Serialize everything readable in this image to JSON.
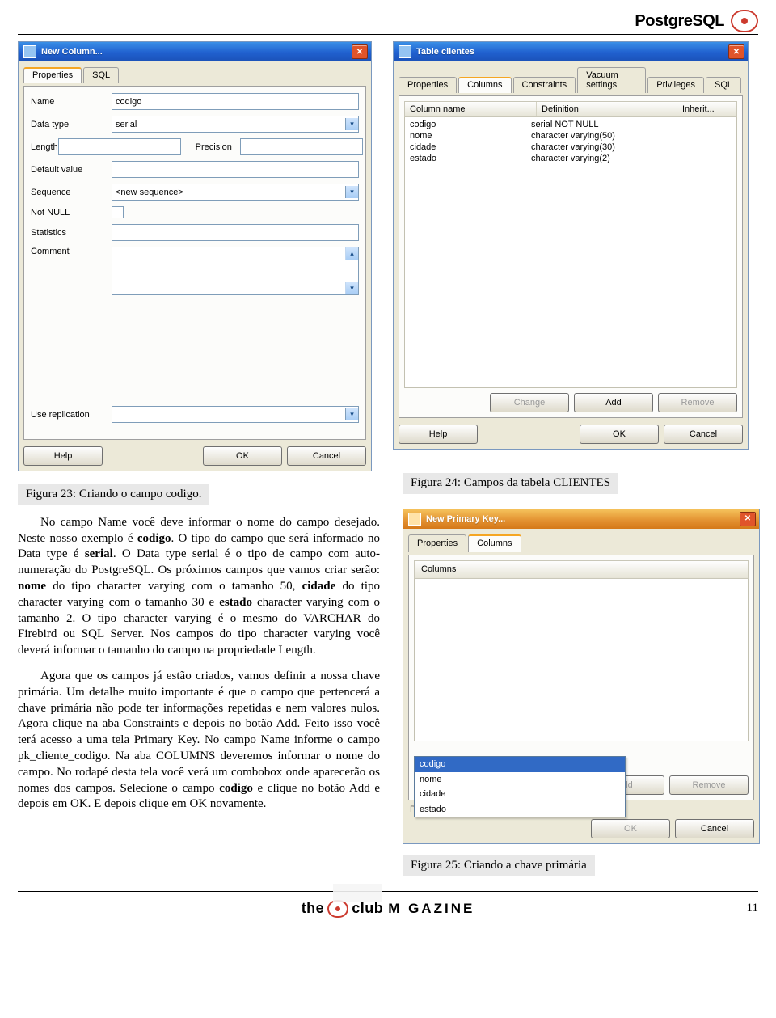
{
  "header": {
    "title": "PostgreSQL"
  },
  "newColumn": {
    "title": "New Column...",
    "tabs": {
      "properties": "Properties",
      "sql": "SQL"
    },
    "labels": {
      "name": "Name",
      "dataType": "Data type",
      "length": "Length",
      "precision": "Precision",
      "defaultValue": "Default value",
      "sequence": "Sequence",
      "notNull": "Not NULL",
      "statistics": "Statistics",
      "comment": "Comment",
      "useReplication": "Use replication"
    },
    "values": {
      "name": "codigo",
      "dataType": "serial",
      "sequence": "<new sequence>"
    },
    "buttons": {
      "help": "Help",
      "ok": "OK",
      "cancel": "Cancel"
    }
  },
  "tableClientes": {
    "title": "Table clientes",
    "tabs": {
      "properties": "Properties",
      "columns": "Columns",
      "constraints": "Constraints",
      "vacuum": "Vacuum settings",
      "privileges": "Privileges",
      "sql": "SQL"
    },
    "headers": {
      "columnName": "Column name",
      "definition": "Definition",
      "inherit": "Inherit..."
    },
    "rows": [
      {
        "name": "codigo",
        "def": "serial NOT NULL"
      },
      {
        "name": "nome",
        "def": "character varying(50)"
      },
      {
        "name": "cidade",
        "def": "character varying(30)"
      },
      {
        "name": "estado",
        "def": "character varying(2)"
      }
    ],
    "buttons": {
      "change": "Change",
      "add": "Add",
      "remove": "Remove",
      "help": "Help",
      "ok": "OK",
      "cancel": "Cancel"
    }
  },
  "captions": {
    "fig23": "Figura 23: Criando o campo codigo.",
    "fig24": "Figura 24: Campos da tabela CLIENTES",
    "fig25": "Figura 25: Criando a chave primária"
  },
  "article": {
    "p1a": "No campo Name você deve informar o nome do campo desejado. Neste nosso exemplo é ",
    "p1b": "codigo",
    "p1c": ". O tipo do campo que será informado no Data type é ",
    "p1d": "serial",
    "p1e": ". O Data type serial é o tipo de campo com auto-numeração do PostgreSQL. Os próximos campos que vamos criar serão: ",
    "p1f": "nome",
    "p1g": " do tipo character varying com o tamanho 50, ",
    "p1h": "cidade",
    "p1i": " do tipo character varying com o tamanho 30 e ",
    "p1j": "estado",
    "p1k": " character varying com o tamanho 2. O tipo character varying é o mesmo do VARCHAR do Firebird ou SQL Server. Nos campos do tipo character varying você deverá informar o tamanho do campo na propriedade Length.",
    "p2a": "Agora que os campos já estão criados, vamos definir a nossa chave primária. Um detalhe muito importante é que o campo que pertencerá a chave primária não pode ter informações repetidas e nem valores nulos. Agora clique na aba Constraints e depois no botão Add. Feito isso você terá acesso a uma tela Primary Key. No campo Name informe o campo pk_cliente_codigo. Na aba COLUMNS deveremos informar o nome do campo. No rodapé desta tela você verá um combobox onde aparecerão os nomes dos campos. Selecione o campo ",
    "p2b": "codigo",
    "p2c": " e clique no botão Add e depois em OK. E depois clique em OK novamente."
  },
  "primaryKey": {
    "title": "New Primary Key...",
    "tabs": {
      "properties": "Properties",
      "columns": "Columns"
    },
    "colHeader": "Columns",
    "options": [
      "codigo",
      "nome",
      "cidade",
      "estado"
    ],
    "selected": "codigo",
    "hint": "Please specify columns.",
    "buttons": {
      "add": "Add",
      "remove": "Remove",
      "ok": "OK",
      "cancel": "Cancel"
    }
  },
  "footer": {
    "brand1": "the",
    "brand2": "club",
    "mag": "M   GAZINE",
    "pagenum": "11"
  }
}
